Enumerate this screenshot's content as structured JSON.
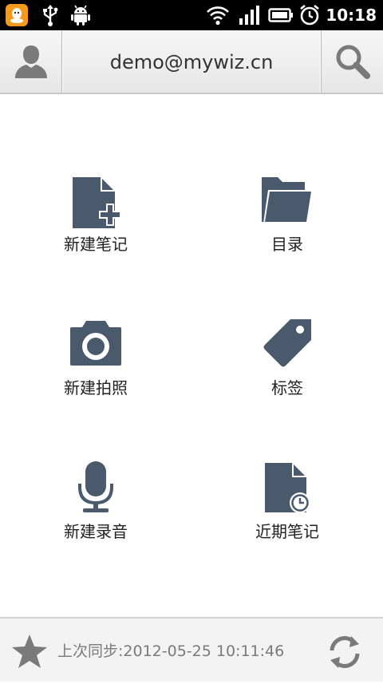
{
  "status_bar": {
    "time": "10:18",
    "icons": [
      "qq-notification-icon",
      "usb-icon",
      "android-debug-icon",
      "wifi-icon",
      "signal-icon",
      "battery-icon",
      "alarm-icon"
    ]
  },
  "header": {
    "account_email": "demo@mywiz.cn",
    "left_icon": "person-icon",
    "right_icon": "search-icon"
  },
  "actions": [
    {
      "id": "new-note",
      "label": "新建笔记",
      "icon": "new-note-icon"
    },
    {
      "id": "directory",
      "label": "目录",
      "icon": "folder-icon"
    },
    {
      "id": "new-photo",
      "label": "新建拍照",
      "icon": "camera-icon"
    },
    {
      "id": "tags",
      "label": "标签",
      "icon": "tag-icon"
    },
    {
      "id": "new-recording",
      "label": "新建录音",
      "icon": "microphone-icon"
    },
    {
      "id": "recent-notes",
      "label": "近期笔记",
      "icon": "recent-note-icon"
    }
  ],
  "footer": {
    "last_sync": "上次同步:2012-05-25 10:11:46",
    "left_icon": "star-icon",
    "right_icon": "sync-icon"
  },
  "colors": {
    "icon_fill": "#4a5a6c",
    "header_icon": "#7a7a7a",
    "footer_text": "#7a7a7a",
    "qq_orange": "#f59a1b"
  }
}
